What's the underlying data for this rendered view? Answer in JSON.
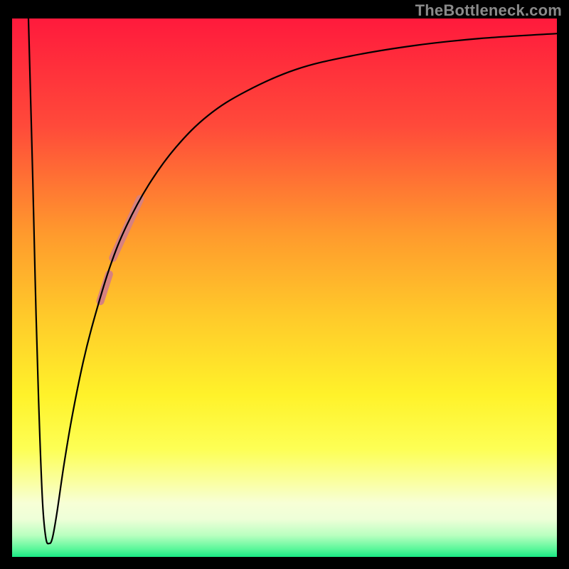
{
  "watermark": "TheBottleneck.com",
  "chart_data": {
    "type": "line",
    "title": "",
    "xlabel": "",
    "ylabel": "",
    "xlim": [
      0,
      100
    ],
    "ylim": [
      0,
      100
    ],
    "grid": false,
    "legend": false,
    "background_gradient": {
      "stops": [
        {
          "offset": 0.0,
          "color": "#ff1a3c"
        },
        {
          "offset": 0.2,
          "color": "#ff4a3a"
        },
        {
          "offset": 0.4,
          "color": "#ff9a2d"
        },
        {
          "offset": 0.55,
          "color": "#ffc92a"
        },
        {
          "offset": 0.7,
          "color": "#fff22a"
        },
        {
          "offset": 0.8,
          "color": "#fdff55"
        },
        {
          "offset": 0.86,
          "color": "#faffa0"
        },
        {
          "offset": 0.9,
          "color": "#f7ffd6"
        },
        {
          "offset": 0.93,
          "color": "#eeffd8"
        },
        {
          "offset": 0.96,
          "color": "#b9ffc0"
        },
        {
          "offset": 0.985,
          "color": "#5cf79b"
        },
        {
          "offset": 1.0,
          "color": "#19e884"
        }
      ]
    },
    "series": [
      {
        "name": "curve",
        "stroke": "#000000",
        "stroke_width": 2.2,
        "points": [
          {
            "x": 3.0,
            "y": 100.0
          },
          {
            "x": 3.8,
            "y": 70.0
          },
          {
            "x": 4.4,
            "y": 45.0
          },
          {
            "x": 5.0,
            "y": 25.0
          },
          {
            "x": 5.6,
            "y": 10.0
          },
          {
            "x": 6.2,
            "y": 3.5
          },
          {
            "x": 6.8,
            "y": 2.5
          },
          {
            "x": 7.4,
            "y": 3.5
          },
          {
            "x": 8.2,
            "y": 8.0
          },
          {
            "x": 9.5,
            "y": 17.0
          },
          {
            "x": 11.0,
            "y": 26.0
          },
          {
            "x": 13.0,
            "y": 36.0
          },
          {
            "x": 15.0,
            "y": 44.0
          },
          {
            "x": 18.0,
            "y": 54.0
          },
          {
            "x": 21.0,
            "y": 61.5
          },
          {
            "x": 25.0,
            "y": 69.0
          },
          {
            "x": 30.0,
            "y": 76.0
          },
          {
            "x": 36.0,
            "y": 82.0
          },
          {
            "x": 43.0,
            "y": 86.5
          },
          {
            "x": 52.0,
            "y": 90.5
          },
          {
            "x": 62.0,
            "y": 93.0
          },
          {
            "x": 74.0,
            "y": 95.0
          },
          {
            "x": 86.0,
            "y": 96.3
          },
          {
            "x": 100.0,
            "y": 97.2
          }
        ]
      }
    ],
    "highlight_segments": [
      {
        "name": "upper-highlight",
        "color": "#d6817f",
        "stroke_width": 11,
        "points": [
          {
            "x": 18.5,
            "y": 55.5
          },
          {
            "x": 23.5,
            "y": 66.5
          }
        ]
      },
      {
        "name": "lower-highlight",
        "color": "#d6817f",
        "stroke_width": 11,
        "points": [
          {
            "x": 16.2,
            "y": 47.5
          },
          {
            "x": 17.8,
            "y": 52.5
          }
        ]
      }
    ]
  }
}
